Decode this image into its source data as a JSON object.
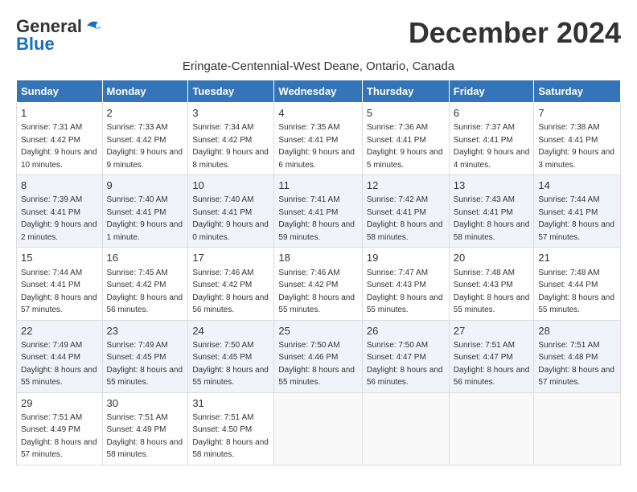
{
  "header": {
    "logo_general": "General",
    "logo_blue": "Blue",
    "month": "December 2024",
    "location": "Eringate-Centennial-West Deane, Ontario, Canada"
  },
  "days_of_week": [
    "Sunday",
    "Monday",
    "Tuesday",
    "Wednesday",
    "Thursday",
    "Friday",
    "Saturday"
  ],
  "weeks": [
    [
      {
        "day": 1,
        "sunrise": "7:31 AM",
        "sunset": "4:42 PM",
        "daylight": "9 hours and 10 minutes."
      },
      {
        "day": 2,
        "sunrise": "7:33 AM",
        "sunset": "4:42 PM",
        "daylight": "9 hours and 9 minutes."
      },
      {
        "day": 3,
        "sunrise": "7:34 AM",
        "sunset": "4:42 PM",
        "daylight": "9 hours and 8 minutes."
      },
      {
        "day": 4,
        "sunrise": "7:35 AM",
        "sunset": "4:41 PM",
        "daylight": "9 hours and 6 minutes."
      },
      {
        "day": 5,
        "sunrise": "7:36 AM",
        "sunset": "4:41 PM",
        "daylight": "9 hours and 5 minutes."
      },
      {
        "day": 6,
        "sunrise": "7:37 AM",
        "sunset": "4:41 PM",
        "daylight": "9 hours and 4 minutes."
      },
      {
        "day": 7,
        "sunrise": "7:38 AM",
        "sunset": "4:41 PM",
        "daylight": "9 hours and 3 minutes."
      }
    ],
    [
      {
        "day": 8,
        "sunrise": "7:39 AM",
        "sunset": "4:41 PM",
        "daylight": "9 hours and 2 minutes."
      },
      {
        "day": 9,
        "sunrise": "7:40 AM",
        "sunset": "4:41 PM",
        "daylight": "9 hours and 1 minute."
      },
      {
        "day": 10,
        "sunrise": "7:40 AM",
        "sunset": "4:41 PM",
        "daylight": "9 hours and 0 minutes."
      },
      {
        "day": 11,
        "sunrise": "7:41 AM",
        "sunset": "4:41 PM",
        "daylight": "8 hours and 59 minutes."
      },
      {
        "day": 12,
        "sunrise": "7:42 AM",
        "sunset": "4:41 PM",
        "daylight": "8 hours and 58 minutes."
      },
      {
        "day": 13,
        "sunrise": "7:43 AM",
        "sunset": "4:41 PM",
        "daylight": "8 hours and 58 minutes."
      },
      {
        "day": 14,
        "sunrise": "7:44 AM",
        "sunset": "4:41 PM",
        "daylight": "8 hours and 57 minutes."
      }
    ],
    [
      {
        "day": 15,
        "sunrise": "7:44 AM",
        "sunset": "4:41 PM",
        "daylight": "8 hours and 57 minutes."
      },
      {
        "day": 16,
        "sunrise": "7:45 AM",
        "sunset": "4:42 PM",
        "daylight": "8 hours and 56 minutes."
      },
      {
        "day": 17,
        "sunrise": "7:46 AM",
        "sunset": "4:42 PM",
        "daylight": "8 hours and 56 minutes."
      },
      {
        "day": 18,
        "sunrise": "7:46 AM",
        "sunset": "4:42 PM",
        "daylight": "8 hours and 55 minutes."
      },
      {
        "day": 19,
        "sunrise": "7:47 AM",
        "sunset": "4:43 PM",
        "daylight": "8 hours and 55 minutes."
      },
      {
        "day": 20,
        "sunrise": "7:48 AM",
        "sunset": "4:43 PM",
        "daylight": "8 hours and 55 minutes."
      },
      {
        "day": 21,
        "sunrise": "7:48 AM",
        "sunset": "4:44 PM",
        "daylight": "8 hours and 55 minutes."
      }
    ],
    [
      {
        "day": 22,
        "sunrise": "7:49 AM",
        "sunset": "4:44 PM",
        "daylight": "8 hours and 55 minutes."
      },
      {
        "day": 23,
        "sunrise": "7:49 AM",
        "sunset": "4:45 PM",
        "daylight": "8 hours and 55 minutes."
      },
      {
        "day": 24,
        "sunrise": "7:50 AM",
        "sunset": "4:45 PM",
        "daylight": "8 hours and 55 minutes."
      },
      {
        "day": 25,
        "sunrise": "7:50 AM",
        "sunset": "4:46 PM",
        "daylight": "8 hours and 55 minutes."
      },
      {
        "day": 26,
        "sunrise": "7:50 AM",
        "sunset": "4:47 PM",
        "daylight": "8 hours and 56 minutes."
      },
      {
        "day": 27,
        "sunrise": "7:51 AM",
        "sunset": "4:47 PM",
        "daylight": "8 hours and 56 minutes."
      },
      {
        "day": 28,
        "sunrise": "7:51 AM",
        "sunset": "4:48 PM",
        "daylight": "8 hours and 57 minutes."
      }
    ],
    [
      {
        "day": 29,
        "sunrise": "7:51 AM",
        "sunset": "4:49 PM",
        "daylight": "8 hours and 57 minutes."
      },
      {
        "day": 30,
        "sunrise": "7:51 AM",
        "sunset": "4:49 PM",
        "daylight": "8 hours and 58 minutes."
      },
      {
        "day": 31,
        "sunrise": "7:51 AM",
        "sunset": "4:50 PM",
        "daylight": "8 hours and 58 minutes."
      },
      null,
      null,
      null,
      null
    ]
  ]
}
